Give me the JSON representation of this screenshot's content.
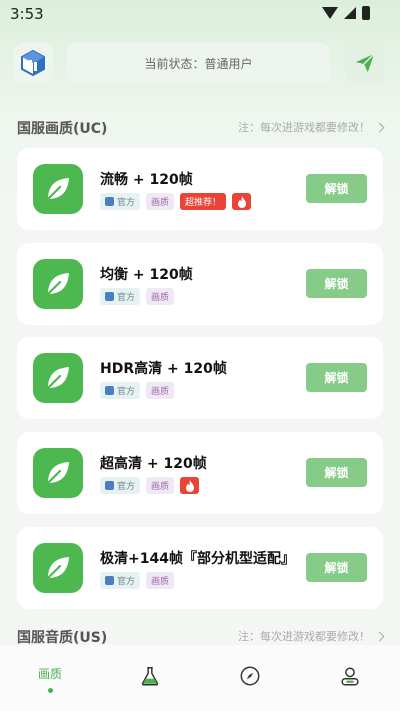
{
  "status_bar": {
    "time": "3:53"
  },
  "header": {
    "status_text": "当前状态：普通用户"
  },
  "sections": [
    {
      "title": "国服画质(UC)",
      "note": "注：每次进游戏都要修改！"
    },
    {
      "title": "国服音质(US)",
      "note": "注：每次进游戏都要修改！"
    }
  ],
  "cards": [
    {
      "title": "流畅 + 120帧",
      "tag_official": "官方",
      "tag_quality": "画质",
      "tag_hot": "超推荐！",
      "button": "解锁"
    },
    {
      "title": "均衡 + 120帧",
      "tag_official": "官方",
      "tag_quality": "画质",
      "button": "解锁"
    },
    {
      "title": "HDR高清 + 120帧",
      "tag_official": "官方",
      "tag_quality": "画质",
      "button": "解锁"
    },
    {
      "title": "超高清 + 120帧",
      "tag_official": "官方",
      "tag_quality": "画质",
      "button": "解锁"
    },
    {
      "title": "极清+144帧『部分机型适配』",
      "tag_official": "官方",
      "tag_quality": "画质",
      "button": "解锁"
    }
  ],
  "nav": {
    "active_label": "画质"
  },
  "colors": {
    "accent": "#4caf50",
    "button": "#86cc88",
    "hot": "#ea4437",
    "icon_bg": "#4db84f"
  }
}
